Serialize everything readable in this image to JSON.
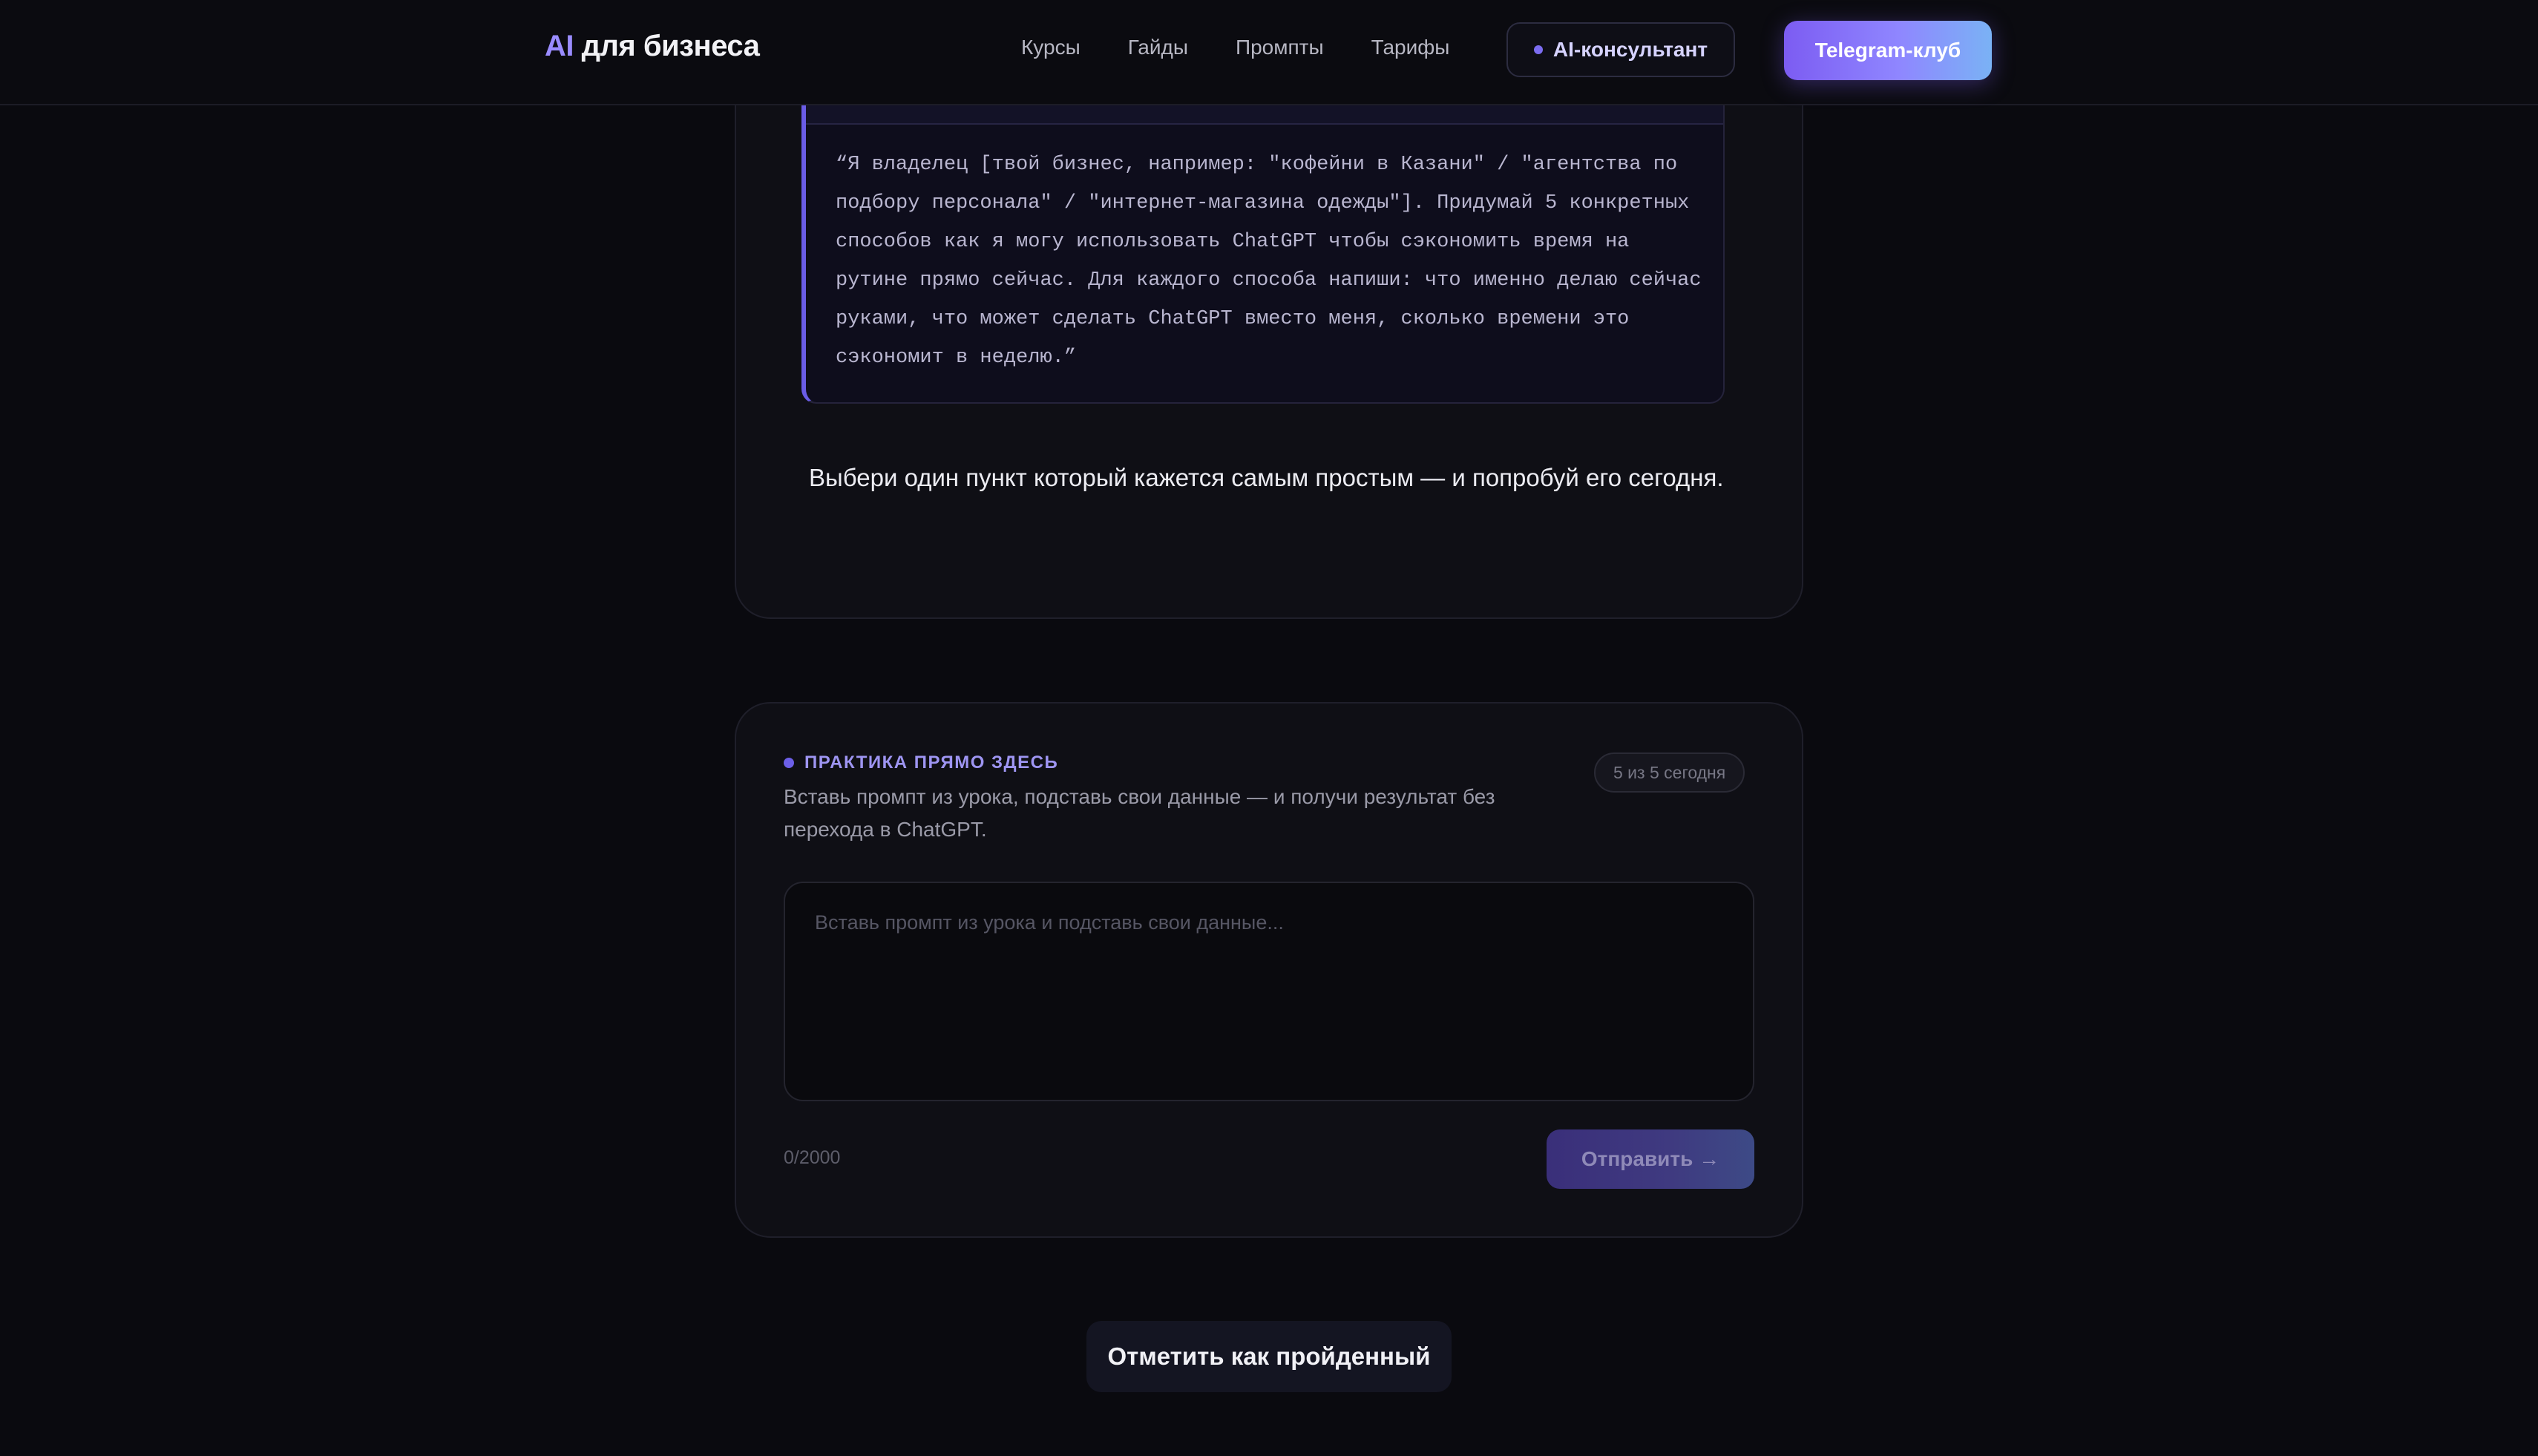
{
  "header": {
    "logo_accent": "AI",
    "logo_rest": " для бизнеса",
    "nav": [
      {
        "label": "Курсы"
      },
      {
        "label": "Гайды"
      },
      {
        "label": "Промпты"
      },
      {
        "label": "Тарифы"
      }
    ],
    "consultant_label": "AI-консультант",
    "telegram_label": "Telegram-клуб"
  },
  "lesson": {
    "prompt_text": "“Я владелец [твой бизнес, например: \"кофейни в Казани\" / \"агентства по подбору персонала\" / \"интернет-магазина одежды\"]. Придумай 5 конкретных способов как я могу использовать ChatGPT чтобы сэкономить время на рутине прямо сейчас. Для каждого способа напиши: что именно делаю сейчас руками, что может сделать ChatGPT вместо меня, сколько времени это сэкономит в неделю.”",
    "note": "Выбери один пункт который кажется самым простым — и попробуй его сегодня."
  },
  "practice": {
    "label": "ПРАКТИКА ПРЯМО ЗДЕСЬ",
    "description": "Вставь промпт из урока, подставь свои данные — и получи результат без перехода в ChatGPT.",
    "counter": "5 из 5 сегодня",
    "input_placeholder": "Вставь промпт из урока и подставь свои данные...",
    "input_value": "",
    "char_count": "0/2000",
    "send_label": "Отправить →"
  },
  "complete_label": "Отметить как пройденный",
  "colors": {
    "background": "#0a0a0f",
    "card": "#0f0f15",
    "accent": "#7c5cf2",
    "accent_light": "#9a8cff"
  }
}
